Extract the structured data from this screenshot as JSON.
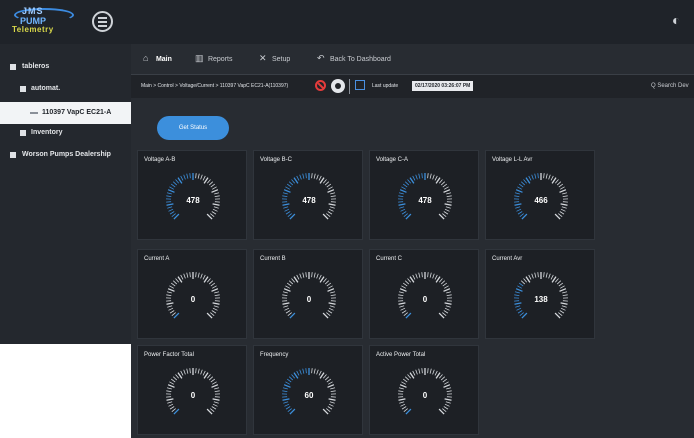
{
  "header": {
    "logo": {
      "line1": "JMS",
      "line2": "PUMP",
      "line3": "Telemetry"
    },
    "menu_icon": "hamburger-icon",
    "right_icon": "toggle-icon"
  },
  "sidebar": {
    "items": [
      {
        "label": "tableros",
        "icon": "list-icon"
      },
      {
        "label": "automat.",
        "icon": "list-icon"
      },
      {
        "label": "110397 VapC EC21-A",
        "icon": "dash-icon"
      },
      {
        "label": "Inventory",
        "icon": "list-icon"
      },
      {
        "label": "Worson Pumps Dealership",
        "icon": "list-icon"
      }
    ]
  },
  "nav": {
    "items": [
      {
        "label": "Main",
        "icon": "home-icon"
      },
      {
        "label": "Reports",
        "icon": "chart-icon"
      },
      {
        "label": "Setup",
        "icon": "tools-icon"
      },
      {
        "label": "Back To Dashboard",
        "icon": "back-icon"
      }
    ]
  },
  "breadcrumb": {
    "text": "Main > Control > Voltage/Current > 110397 VapC EC21-A(110397)",
    "last_update_label": "Last update",
    "last_update_value": "02/17/2020 03:26:07 PM"
  },
  "search": {
    "placeholder": "Q Search Dev"
  },
  "status_button": {
    "label": "Get Status"
  },
  "colors": {
    "accent": "#3c8fdc",
    "card_bg": "#1d2025",
    "main_bg": "#282c32"
  },
  "gauges": [
    {
      "title": "Voltage A-B",
      "value": "478",
      "fill": 0.5
    },
    {
      "title": "Voltage B-C",
      "value": "478",
      "fill": 0.5
    },
    {
      "title": "Voltage C-A",
      "value": "478",
      "fill": 0.5
    },
    {
      "title": "Voltage L-L Avr",
      "value": "466",
      "fill": 0.49
    },
    {
      "title": "Current A",
      "value": "0",
      "fill": 0.02
    },
    {
      "title": "Current B",
      "value": "0",
      "fill": 0.02
    },
    {
      "title": "Current C",
      "value": "0",
      "fill": 0.02
    },
    {
      "title": "Current Avr",
      "value": "138",
      "fill": 0.3
    },
    {
      "title": "Power Factor Total",
      "value": "0",
      "fill": 0
    },
    {
      "title": "Frequency",
      "value": "60",
      "fill": 0.5
    },
    {
      "title": "Active Power Total",
      "value": "0",
      "fill": 0.02
    }
  ]
}
